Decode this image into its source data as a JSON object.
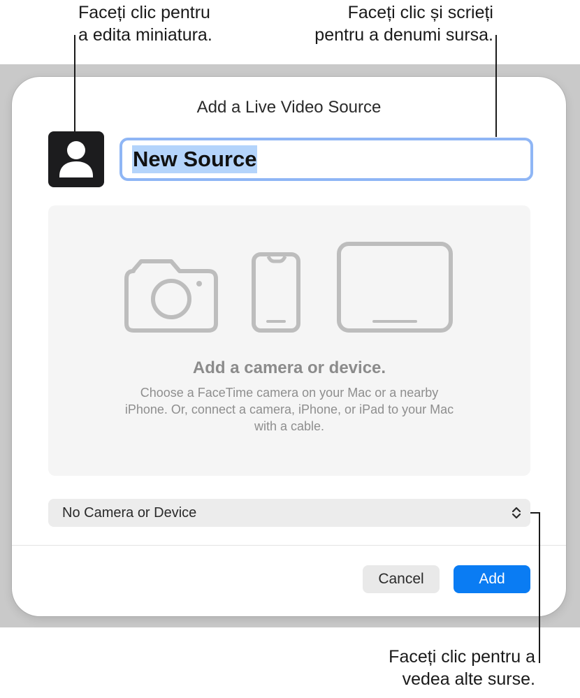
{
  "callouts": {
    "thumbnail": [
      "Faceți clic pentru",
      "a edita miniatura."
    ],
    "name": [
      "Faceți clic și scrieți",
      "pentru a denumi sursa."
    ],
    "sources": [
      "Faceți clic pentru a",
      "vedea alte surse."
    ]
  },
  "dialog": {
    "title": "Add a Live Video Source",
    "thumbnail_icon": "person-silhouette-icon",
    "source_name": "New Source",
    "drop_area": {
      "icons": [
        "camera-icon",
        "iphone-icon",
        "ipad-icon"
      ],
      "heading": "Add a camera or device.",
      "description_lines": [
        "Choose a FaceTime camera on your Mac or a nearby",
        "iPhone. Or, connect a camera, iPhone, or iPad to your Mac",
        "with a cable."
      ]
    },
    "source_select": {
      "selected": "No Camera or Device",
      "icon": "up-down-chevron-icon"
    },
    "buttons": {
      "cancel": "Cancel",
      "add": "Add"
    }
  },
  "colors": {
    "accent": "#0a7cf3",
    "focus_ring": "#8fb6f5",
    "selection": "#b4d4fb",
    "thumbnail_bg": "#1c1c1e",
    "backdrop": "#c9c9c9"
  }
}
